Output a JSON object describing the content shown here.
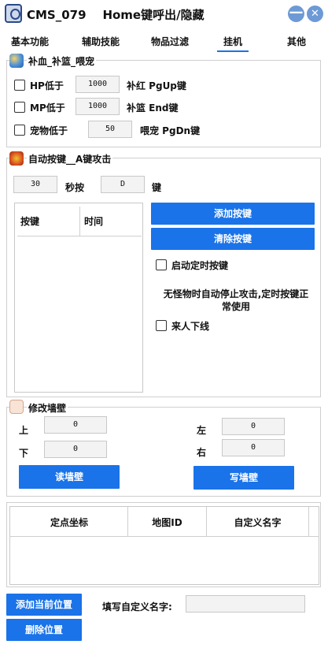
{
  "window": {
    "title": "CMS_079    Home键呼出/隐藏",
    "minimize_glyph": "—",
    "close_glyph": "✕",
    "accent_color": "#1a73e8"
  },
  "tabs": [
    "基本功能",
    "辅助技能",
    "物品过滤",
    "挂机",
    "其他"
  ],
  "active_tab": "挂机",
  "heal": {
    "title": "补血_补篮_喂宠",
    "rows": [
      {
        "label": "HP低于",
        "value": "1000",
        "hint": "补红 PgUp键"
      },
      {
        "label": "MP低于",
        "value": "1000",
        "hint": "补篮 End键"
      },
      {
        "label": "宠物低于",
        "value": "50",
        "hint": "喂宠 PgDn键"
      }
    ]
  },
  "autokey": {
    "title": "自动按键__A键攻击",
    "seconds": "30",
    "seconds_label": "秒按",
    "key": "D",
    "key_label": "键",
    "table_headers": [
      "按键",
      "时间"
    ],
    "add_button": "添加按键",
    "clear_button": "清除按键",
    "timer_checkbox": "启动定时按键",
    "note": "无怪物时自动停止攻击,定时按键正常使用",
    "logout_checkbox": "来人下线"
  },
  "wall": {
    "title": "修改墙壁",
    "up_label": "上",
    "up_value": "0",
    "down_label": "下",
    "down_value": "0",
    "left_label": "左",
    "left_value": "0",
    "right_label": "右",
    "right_value": "0",
    "read_button": "读墙壁",
    "write_button": "写墙壁"
  },
  "points": {
    "headers": [
      "定点坐标",
      "地图ID",
      "自定义名字"
    ],
    "add_button": "添加当前位置",
    "delete_button": "删除位置",
    "name_label": "填写自定义名字:",
    "name_value": ""
  }
}
